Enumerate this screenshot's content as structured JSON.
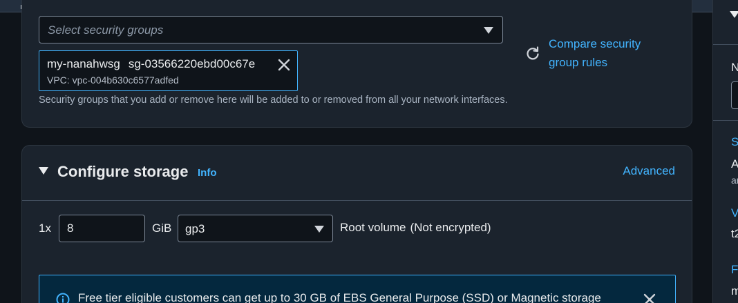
{
  "security_groups": {
    "select_placeholder": "Select security groups",
    "selected": {
      "name": "my-nanahwsg",
      "id": "sg-03566220ebd00c67e",
      "vpc": "VPC: vpc-004b630c6577adfed"
    },
    "compare_link": "Compare security group rules",
    "help_text": "Security groups that you add or remove here will be added to or removed from all your network interfaces."
  },
  "storage": {
    "title": "Configure storage",
    "info_link": "Info",
    "advanced_link": "Advanced",
    "multiplier": "1x",
    "size_value": "8",
    "size_unit": "GiB",
    "volume_type": "gp3",
    "root_label": "Root volume",
    "encryption_label": "(Not encrypted)",
    "free_tier_message": "Free tier eligible customers can get up to 30 GB of EBS General Purpose (SSD) or Magnetic storage"
  },
  "summary_fragments": {
    "c1": "N",
    "c2": "S",
    "c3": "A",
    "c4": "ar",
    "c5": "V",
    "c6": "t2",
    "c7": "Fi",
    "c8": "m"
  },
  "colors": {
    "link": "#42b4ff",
    "panel_bg": "#1b232d",
    "page_bg": "#0f141a",
    "flash_bg": "#04283e"
  },
  "icons": [
    "refresh-icon",
    "close-icon",
    "info-icon",
    "caret-down-icon"
  ]
}
